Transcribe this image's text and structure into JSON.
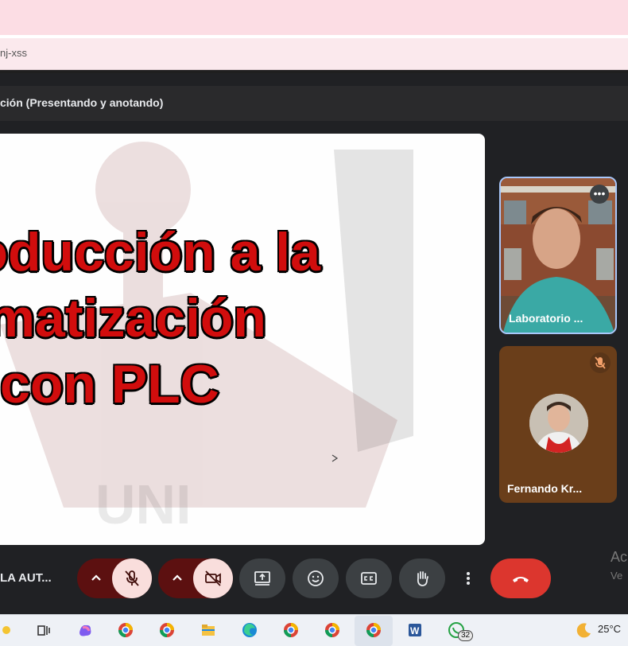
{
  "browser": {
    "url_fragment": "nj-xss"
  },
  "meeting": {
    "presentation_title": "ción (Presentando y anotando)",
    "meeting_name": "LA AUT..."
  },
  "slide": {
    "lines": [
      "roducción a la",
      "omatización",
      "con PLC"
    ],
    "watermark": "UNI"
  },
  "participants": [
    {
      "name": "Laboratorio ...",
      "more_label": "•••"
    },
    {
      "name": "Fernando Kr..."
    }
  ],
  "controls": {
    "mic_muted": true,
    "camera_off": true,
    "end_call_color": "#dc362e"
  },
  "windows_watermark": {
    "title": "Ac",
    "subtitle": "Ve"
  },
  "taskbar": {
    "whatsapp_badge": "32",
    "temperature": "25°C"
  }
}
